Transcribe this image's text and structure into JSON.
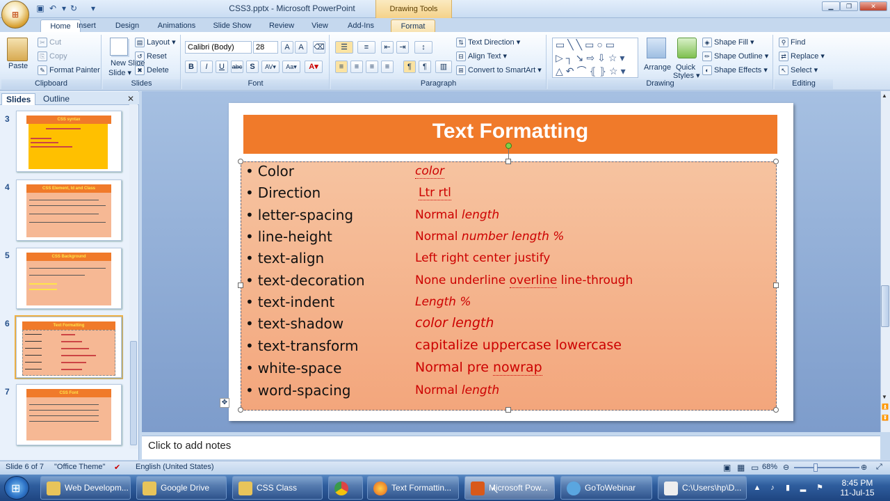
{
  "window": {
    "title": "CSS3.pptx - Microsoft PowerPoint",
    "contextual_tab_group": "Drawing Tools"
  },
  "tabs": [
    "Home",
    "Insert",
    "Design",
    "Animations",
    "Slide Show",
    "Review",
    "View",
    "Add-Ins",
    "Format"
  ],
  "active_tab": "Home",
  "ribbon": {
    "clipboard": {
      "paste": "Paste",
      "cut": "Cut",
      "copy": "Copy",
      "format_painter": "Format Painter",
      "label": "Clipboard"
    },
    "slides": {
      "new_slide": "New Slide",
      "new_slide_2": "Slide",
      "layout": "Layout",
      "reset": "Reset",
      "delete": "Delete",
      "label": "Slides"
    },
    "font": {
      "font_name": "Calibri (Body)",
      "font_size": "28",
      "label": "Font"
    },
    "paragraph": {
      "text_direction": "Text Direction",
      "align_text": "Align Text",
      "convert_smartart": "Convert to SmartArt",
      "label": "Paragraph"
    },
    "drawing": {
      "arrange": "Arrange",
      "quick_styles": "Quick",
      "quick_styles_2": "Styles",
      "shape_fill": "Shape Fill",
      "shape_outline": "Shape Outline",
      "shape_effects": "Shape Effects",
      "label": "Drawing"
    },
    "editing": {
      "find": "Find",
      "replace": "Replace",
      "select": "Select",
      "label": "Editing"
    }
  },
  "pane": {
    "tab_slides": "Slides",
    "tab_outline": "Outline"
  },
  "thumbnails": [
    {
      "num": "3",
      "title": "CSS syntax"
    },
    {
      "num": "4",
      "title": "CSS Element, Id and Class"
    },
    {
      "num": "5",
      "title": "CSS Background"
    },
    {
      "num": "6",
      "title": "Text Formatting"
    },
    {
      "num": "7",
      "title": "CSS Font"
    }
  ],
  "slide": {
    "title": "Text Formatting",
    "rows": [
      {
        "prop": "Color",
        "val": "color"
      },
      {
        "prop": "Direction",
        "val": "Ltr rtl"
      },
      {
        "prop": "letter-spacing",
        "val_a": "Normal ",
        "val_b": "length"
      },
      {
        "prop": "line-height",
        "val_a": "Normal ",
        "val_b": "number length %"
      },
      {
        "prop": "text-align",
        "val": "Left right center justify"
      },
      {
        "prop": "text-decoration",
        "val_a": "None underline ",
        "val_b": "overline",
        "val_c": " line-through"
      },
      {
        "prop": "text-indent",
        "val": "Length %"
      },
      {
        "prop": "text-shadow",
        "val": "color length"
      },
      {
        "prop": "text-transform",
        "val": "capitalize  uppercase  lowercase"
      },
      {
        "prop": "white-space",
        "val_a": "Normal pre ",
        "val_b": "nowrap"
      },
      {
        "prop": "word-spacing",
        "val_a": "Normal ",
        "val_b": "length"
      }
    ]
  },
  "notes_placeholder": "Click to add notes",
  "status": {
    "slide": "Slide 6 of 7",
    "theme": "\"Office Theme\"",
    "language": "English (United States)",
    "zoom": "68%"
  },
  "taskbar": {
    "items": [
      "Web Developm...",
      "Google Drive",
      "CSS Class",
      "",
      "Text Formattin...",
      "Microsoft Pow...",
      "GoToWebinar",
      "C:\\Users\\hp\\D..."
    ],
    "time": "8:45 PM",
    "date": "11-Jul-15"
  }
}
